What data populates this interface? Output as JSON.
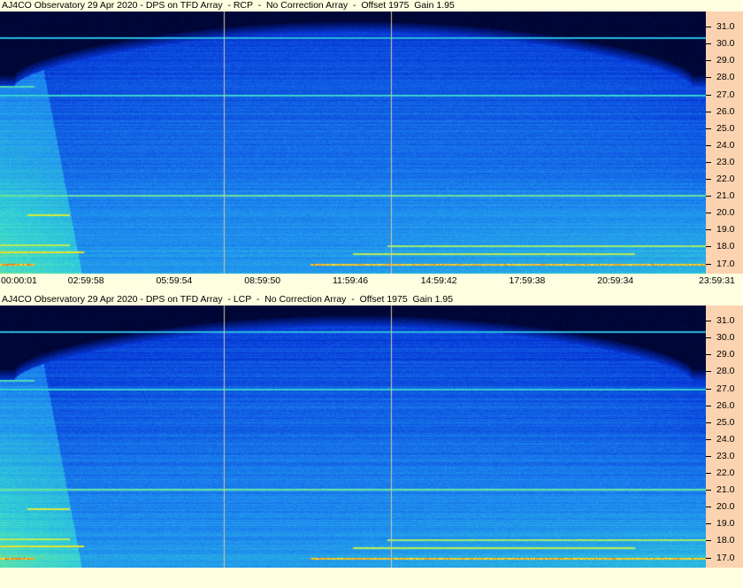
{
  "panels": [
    {
      "title": "AJ4CO Observatory 29 Apr 2020 - DPS on TFD Array  - RCP  -  No Correction Array  -  Offset 1975  Gain 1.95",
      "polarization": "RCP"
    },
    {
      "title": "AJ4CO Observatory 29 Apr 2020 - DPS on TFD Array  - LCP  -  No Correction Array  -  Offset 1975  Gain 1.95",
      "polarization": "LCP"
    }
  ],
  "chart_data": [
    {
      "type": "heatmap",
      "title": "AJ4CO Observatory 29 Apr 2020 - DPS on TFD Array  - RCP  -  No Correction Array  -  Offset 1975  Gain 1.95",
      "xlabel": "",
      "ylabel": "",
      "x_tick_labels": [
        "00:00:01",
        "02:59:58",
        "05:59:54",
        "08:59:50",
        "11:59:46",
        "14:59:42",
        "17:59:38",
        "20:59:34",
        "23:59:31"
      ],
      "y_ticks": [
        17.0,
        18.0,
        19.0,
        20.0,
        21.0,
        22.0,
        23.0,
        24.0,
        25.0,
        26.0,
        27.0,
        28.0,
        29.0,
        30.0,
        31.0
      ],
      "y_tick_labels": [
        "17.0",
        "18.0",
        "19.0",
        "20.0",
        "21.0",
        "22.0",
        "23.0",
        "24.0",
        "25.0",
        "26.0",
        "27.0",
        "28.0",
        "29.0",
        "30.0",
        "31.0"
      ],
      "ylim": [
        16.4,
        31.9
      ],
      "xlim_hours": [
        0,
        24
      ],
      "markers_hours": [
        7.6,
        13.3
      ],
      "colormap": [
        "#000016",
        "#001060",
        "#0638d8",
        "#1e8cf0",
        "#34d6d4",
        "#a8f060",
        "#ffe820",
        "#ff3010"
      ]
    },
    {
      "type": "heatmap",
      "title": "AJ4CO Observatory 29 Apr 2020 - DPS on TFD Array  - LCP  -  No Correction Array  -  Offset 1975  Gain 1.95",
      "xlabel": "",
      "ylabel": "",
      "y_ticks": [
        17.0,
        18.0,
        19.0,
        20.0,
        21.0,
        22.0,
        23.0,
        24.0,
        25.0,
        26.0,
        27.0,
        28.0,
        29.0,
        30.0,
        31.0
      ],
      "y_tick_labels": [
        "17.0",
        "18.0",
        "19.0",
        "20.0",
        "21.0",
        "22.0",
        "23.0",
        "24.0",
        "25.0",
        "26.0",
        "27.0",
        "28.0",
        "29.0",
        "30.0",
        "31.0"
      ],
      "ylim": [
        16.4,
        31.9
      ],
      "xlim_hours": [
        0,
        24
      ],
      "markers_hours": [
        7.6,
        13.3
      ],
      "colormap": [
        "#000016",
        "#001060",
        "#0638d8",
        "#1e8cf0",
        "#34d6d4",
        "#a8f060",
        "#ffe820",
        "#ff3010"
      ]
    }
  ],
  "colors": {
    "background": "#fefee0",
    "axis_background": "#fbd3b0",
    "marker_line": "#d8c8a0"
  }
}
